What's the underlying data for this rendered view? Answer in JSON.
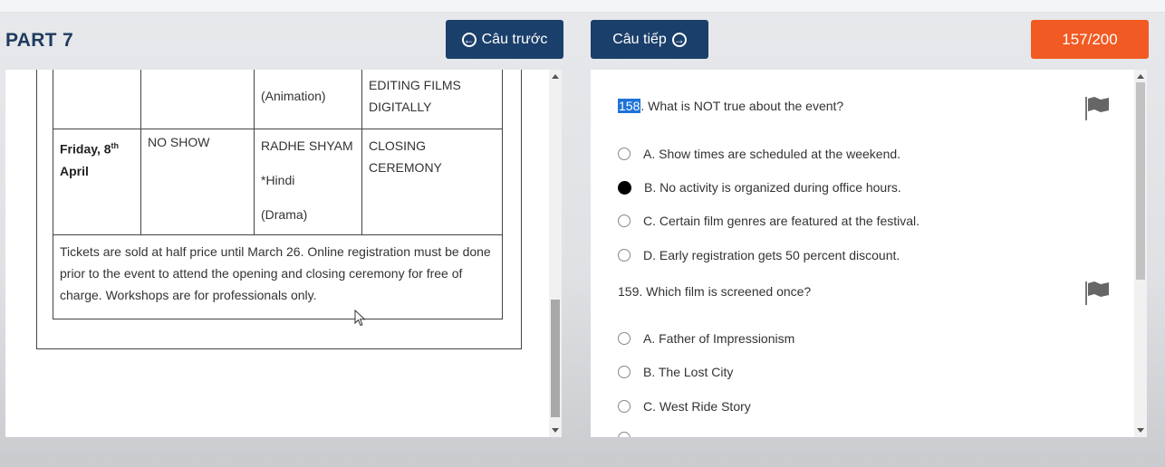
{
  "header": {
    "part_title": "PART 7",
    "prev_label": "Câu trước",
    "next_label": "Câu tiếp",
    "counter": "157/200"
  },
  "schedule": {
    "row_prev": {
      "col1": "",
      "col2": "",
      "col3": "(Animation)",
      "col4": "EDITING FILMS DIGITALLY"
    },
    "row_friday": {
      "day": "Friday, 8",
      "day_sup": "th",
      "day_month": "April",
      "col2": "NO SHOW",
      "col3_line1": "RADHE SHYAM",
      "col3_line2": "*Hindi",
      "col3_line3": "(Drama)",
      "col4": "CLOSING CEREMONY"
    },
    "note": "Tickets are sold at half price until March 26. Online registration must be done prior to the event to attend the opening and closing ceremony for free of charge. Workshops are for professionals only."
  },
  "questions": [
    {
      "number": "158",
      "text": ". What is NOT true about the event?",
      "options": [
        {
          "label": "A. Show times are scheduled at the weekend.",
          "selected": false
        },
        {
          "label": "B. No activity is organized during office hours.",
          "selected": true
        },
        {
          "label": "C. Certain film genres are featured at the festival.",
          "selected": false
        },
        {
          "label": "D. Early registration gets 50 percent discount.",
          "selected": false
        }
      ]
    },
    {
      "number": "159",
      "text": ". Which film is screened once?",
      "options": [
        {
          "label": "A. Father of Impressionism",
          "selected": false
        },
        {
          "label": "B. The Lost City",
          "selected": false
        },
        {
          "label": "C. West Ride Story",
          "selected": false
        }
      ]
    }
  ],
  "icons": {
    "prev": "arrow-left-circle-icon",
    "next": "arrow-right-circle-icon",
    "flag": "flag-icon"
  },
  "colors": {
    "nav_button": "#1b3f6b",
    "counter_button": "#f15a22",
    "highlight": "#1e73d8"
  }
}
